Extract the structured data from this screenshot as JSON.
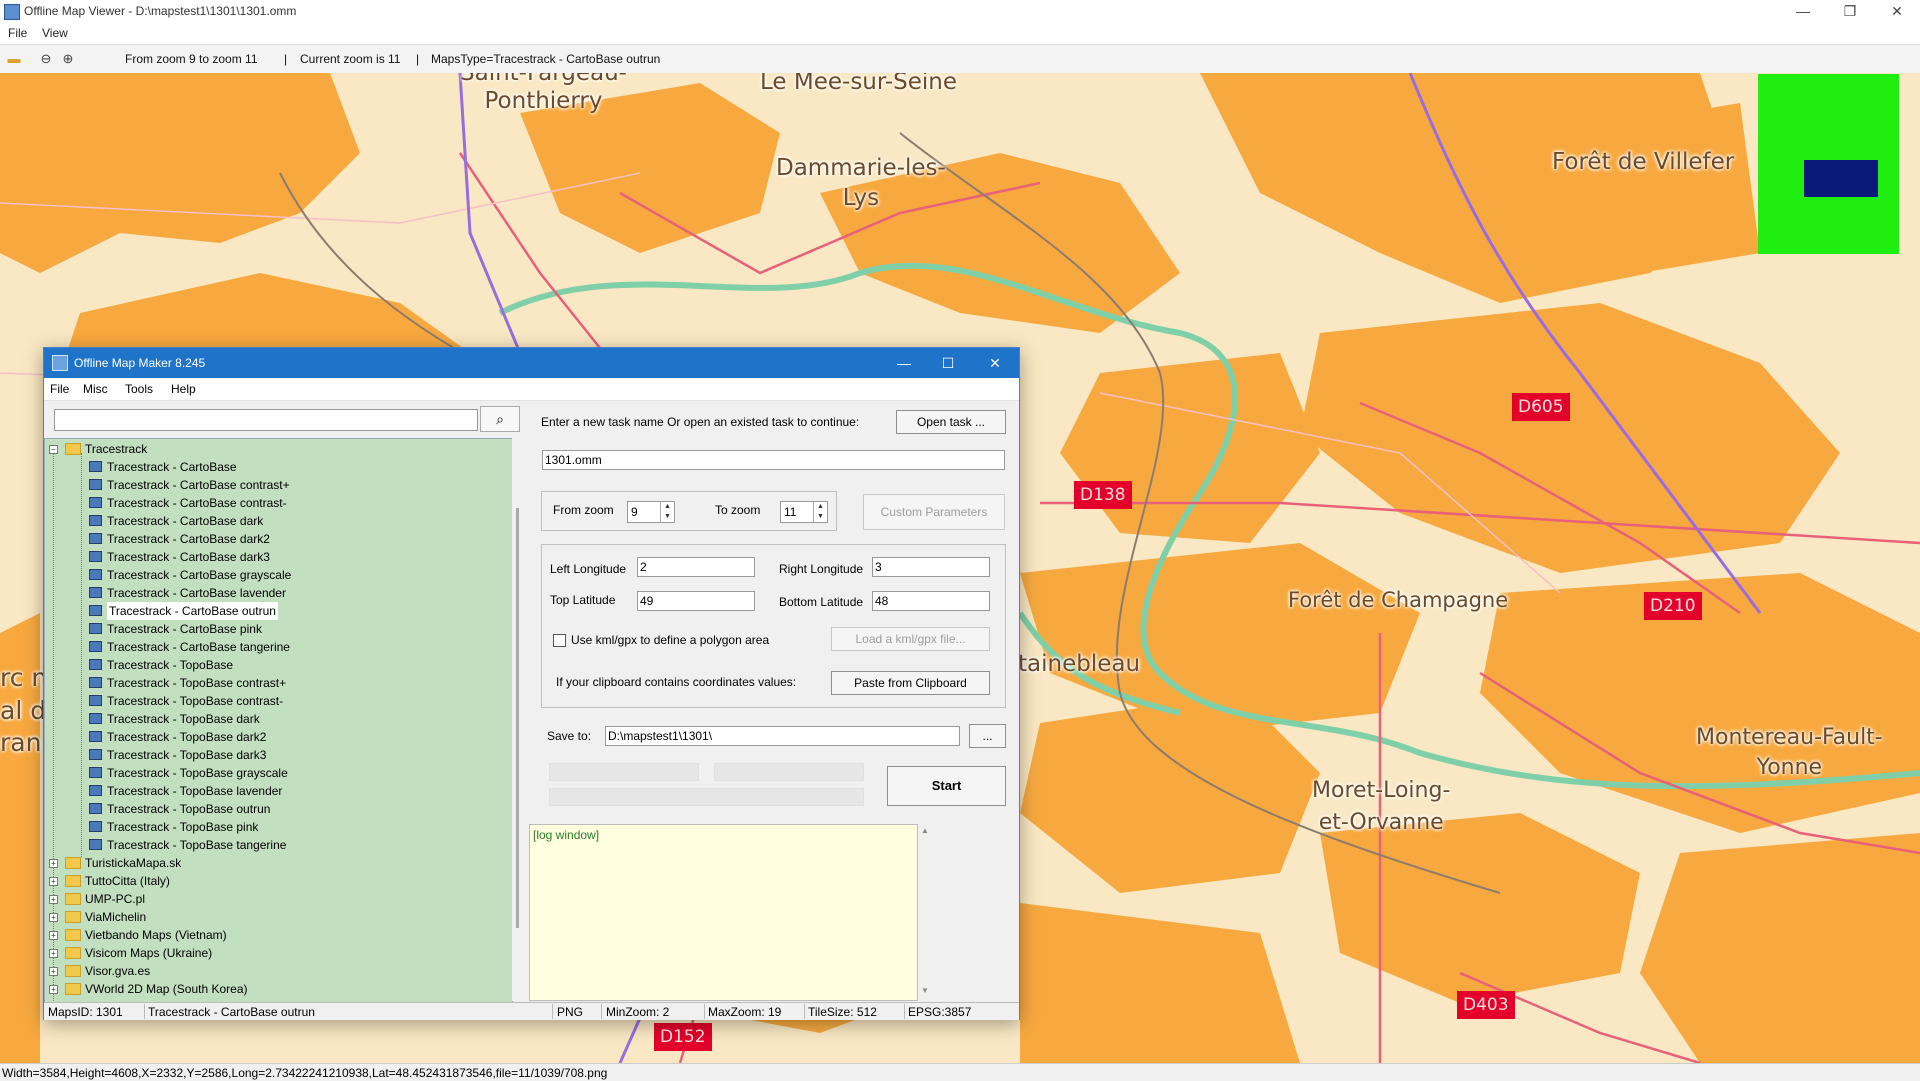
{
  "window": {
    "title": "Offline Map Viewer - D:\\mapstest1\\1301\\1301.omm",
    "menu": [
      "File",
      "View"
    ],
    "controls": {
      "minimize": "—",
      "maximize": "❐",
      "close": "✕"
    }
  },
  "toolbar": {
    "zoom_range": "From zoom 9 to zoom 11",
    "current_zoom": "Current zoom is 11",
    "maps_type": "MapsType=Tracestrack - CartoBase outrun",
    "sep": "|"
  },
  "map": {
    "labels": [
      "Saint-Fargeau-\nPonthierry",
      "Le Mee-sur-Seine",
      "Dammarie-les-\nLys",
      "Forêt de Villefer",
      "Forêt de Champagne",
      "tainebleau",
      "Montereau-Fault-\nYonne",
      "Moret-Loing-\net-Orvanne",
      "rc n",
      "al d",
      "ran"
    ],
    "roads": [
      "D605",
      "D138",
      "D210",
      "D403",
      "D152"
    ],
    "colors": {
      "urban": "#f7a93f",
      "water": "#7fd0a8",
      "rail": "#9b6ce0",
      "road": "#e8607a",
      "background": "#f9e8c3"
    }
  },
  "statusbar": {
    "text": "Width=3584,Height=4608,X=2332,Y=2586,Long=2.73422241210938,Lat=48.452431873546,file=11/1039/708.png"
  },
  "dialog": {
    "title": "Offline Map Maker 8.245",
    "menu": [
      "File",
      "Misc",
      "Tools",
      "Help"
    ],
    "search_value": "",
    "controls": {
      "minimize": "—",
      "maximize": "☐",
      "close": "✕"
    },
    "tree": {
      "root": "Tracestrack",
      "items": [
        "Tracestrack - CartoBase",
        "Tracestrack - CartoBase contrast+",
        "Tracestrack - CartoBase contrast-",
        "Tracestrack - CartoBase dark",
        "Tracestrack - CartoBase dark2",
        "Tracestrack - CartoBase dark3",
        "Tracestrack - CartoBase grayscale",
        "Tracestrack - CartoBase lavender",
        "Tracestrack - CartoBase outrun",
        "Tracestrack - CartoBase pink",
        "Tracestrack - CartoBase tangerine",
        "Tracestrack - TopoBase",
        "Tracestrack - TopoBase contrast+",
        "Tracestrack - TopoBase contrast-",
        "Tracestrack - TopoBase dark",
        "Tracestrack - TopoBase dark2",
        "Tracestrack - TopoBase dark3",
        "Tracestrack - TopoBase grayscale",
        "Tracestrack - TopoBase lavender",
        "Tracestrack - TopoBase outrun",
        "Tracestrack - TopoBase pink",
        "Tracestrack - TopoBase tangerine"
      ],
      "selected": "Tracestrack - CartoBase outrun",
      "folders": [
        "TuristickaMapa.sk",
        "TuttoCitta (Italy)",
        "UMP-PC.pl",
        "ViaMichelin",
        "Vietbando Maps (Vietnam)",
        "Visicom Maps (Ukraine)",
        "Visor.gva.es",
        "VWorld 2D Map (South Korea)"
      ]
    },
    "task_prompt": "Enter a new task name Or open an existed task to continue:",
    "open_task_label": "Open task ...",
    "task_name": "1301.omm",
    "from_zoom_label": "From zoom",
    "from_zoom": "9",
    "to_zoom_label": "To zoom",
    "to_zoom": "11",
    "custom_params_label": "Custom Parameters",
    "left_lon_label": "Left Longitude",
    "left_lon": "2",
    "right_lon_label": "Right Longitude",
    "right_lon": "3",
    "top_lat_label": "Top Latitude",
    "top_lat": "49",
    "bottom_lat_label": "Bottom Latitude",
    "bottom_lat": "48",
    "kml_label": "Use kml/gpx to define a polygon area",
    "kml_checked": false,
    "load_kml_label": "Load a kml/gpx file...",
    "clipboard_prompt": "If your clipboard contains coordinates values:",
    "paste_label": "Paste from Clipboard",
    "save_to_label": "Save to:",
    "save_to": "D:\\mapstest1\\1301\\",
    "browse_label": "...",
    "start_label": "Start",
    "progress": [
      0,
      0,
      0
    ],
    "log_text": "[log window]",
    "status": {
      "maps_id": "MapsID: 1301",
      "map_name": "Tracestrack - CartoBase outrun",
      "format": "PNG",
      "min_zoom": "MinZoom: 2",
      "max_zoom": "MaxZoom: 19",
      "tile_size": "TileSize: 512",
      "epsg": "EPSG:3857"
    }
  }
}
